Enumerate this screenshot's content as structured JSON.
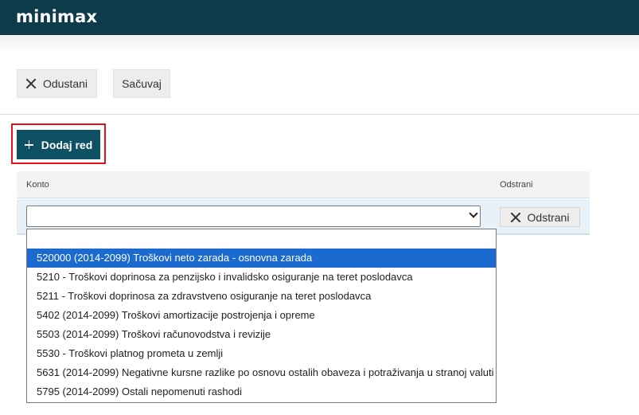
{
  "app": {
    "logo": "minimax"
  },
  "toolbar": {
    "cancel_label": "Odustani",
    "save_label": "Sačuvaj"
  },
  "add_row_label": "Dodaj red",
  "table": {
    "columns": [
      "Konto",
      "Odstrani"
    ],
    "row": {
      "account_value": "",
      "remove_label": "Odstrani"
    }
  },
  "dropdown": {
    "options": [
      "",
      "520000 (2014-2099) Troškovi neto zarada - osnovna zarada",
      "5210 - Troškovi doprinosa za penzijsko i invalidsko osiguranje na teret poslodavca",
      "5211 - Troškovi doprinosa za zdravstveno osiguranje na teret poslodavca",
      "5402 (2014-2099) Troškovi amortizacije postrojenja i opreme",
      "5503 (2014-2099) Troškovi računovodstva i revizije",
      "5530 - Troškovi platnog prometa u zemlji",
      "5631 (2014-2099) Negativne kursne razlike po osnovu ostalih obaveza i potraživanja u stranoj valuti",
      "5795 (2014-2099) Ostali nepomenuti rashodi"
    ],
    "highlighted_index": 1
  },
  "colors": {
    "header": "#0e3b4a",
    "primary": "#0e5165",
    "highlight_frame": "#e8101b",
    "selected_option": "#1b6ad0"
  }
}
